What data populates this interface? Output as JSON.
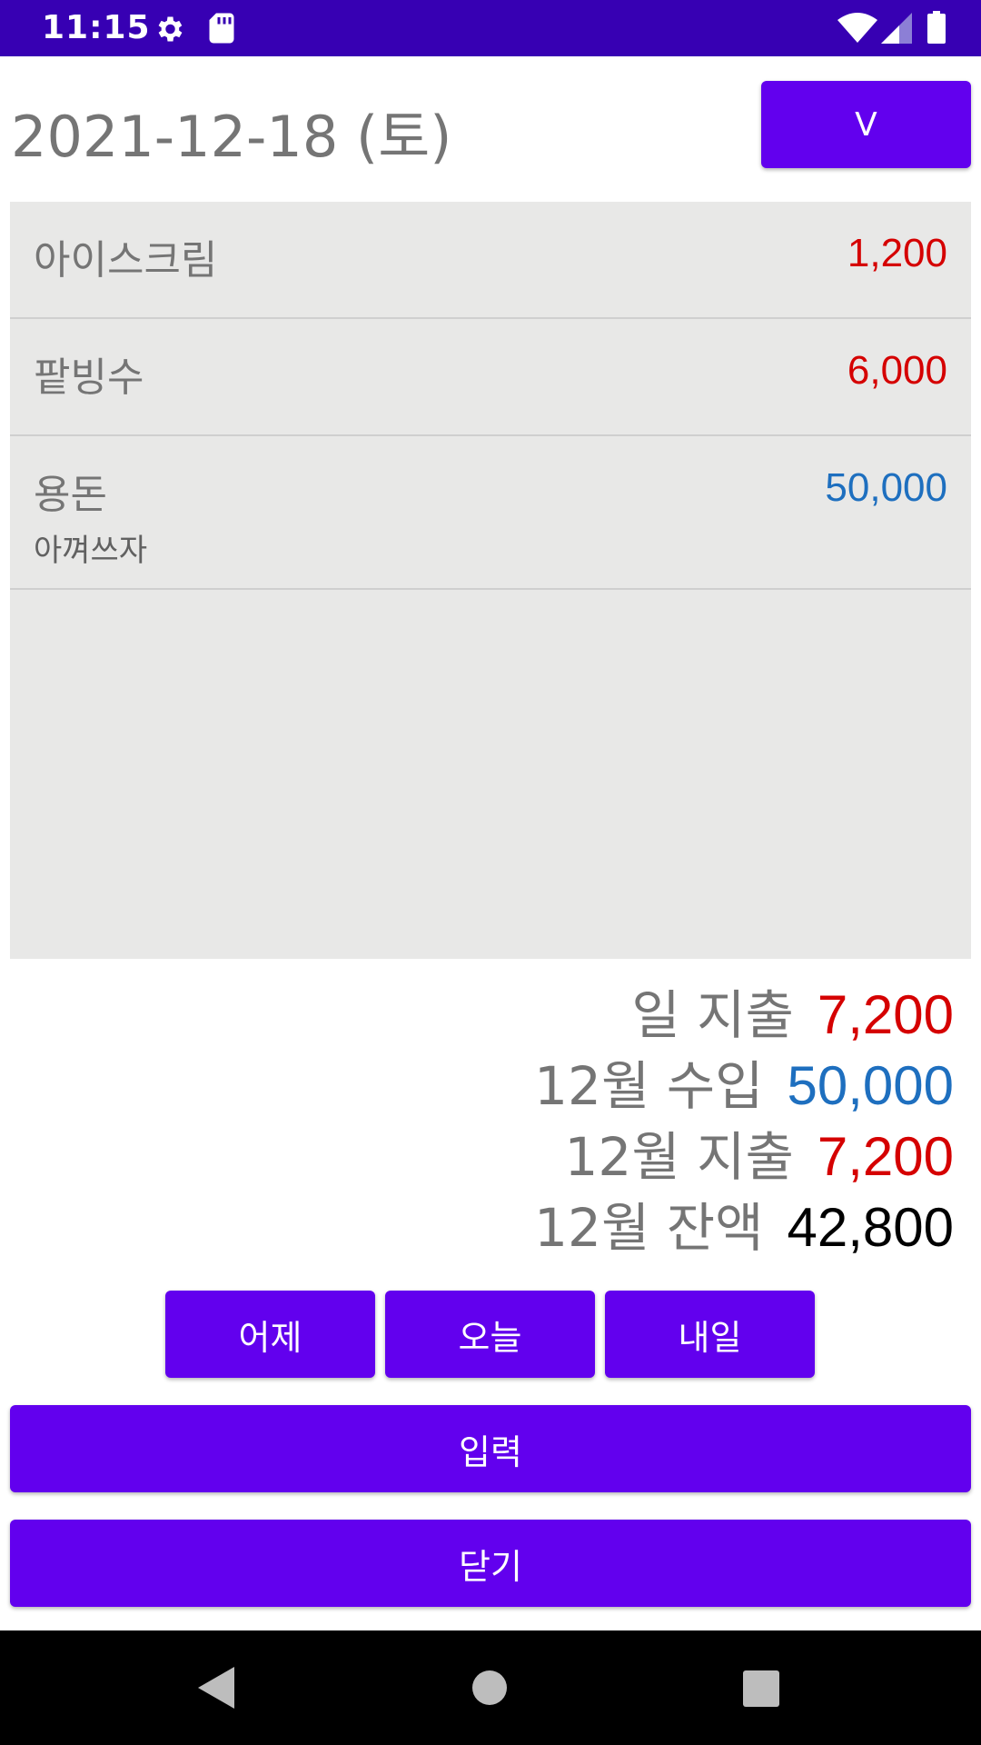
{
  "status_bar": {
    "time": "11:15",
    "icons": [
      "gear-icon",
      "sd-card-icon",
      "wifi-icon",
      "signal-icon",
      "battery-icon"
    ]
  },
  "header": {
    "date": "2021-12-18 (토)",
    "v_button": "V"
  },
  "entries": [
    {
      "name": "아이스크림",
      "amount": "1,200",
      "type": "expense"
    },
    {
      "name": "팥빙수",
      "amount": "6,000",
      "type": "expense"
    },
    {
      "name": "용돈",
      "memo": "아껴쓰자",
      "amount": "50,000",
      "type": "income"
    }
  ],
  "summary": {
    "daily_expense_label": "일 지출",
    "daily_expense_value": "7,200",
    "monthly_income_label": "12월 수입",
    "monthly_income_value": "50,000",
    "monthly_expense_label": "12월 지출",
    "monthly_expense_value": "7,200",
    "monthly_balance_label": "12월 잔액",
    "monthly_balance_value": "42,800"
  },
  "buttons": {
    "yesterday": "어제",
    "today": "오늘",
    "tomorrow": "내일",
    "input": "입력",
    "close": "닫기"
  },
  "colors": {
    "primary": "#6200ee",
    "status_bar": "#3700b3",
    "expense": "#d50000",
    "income": "#1e6fbf",
    "balance": "#000000",
    "list_background": "#e8e8e7"
  },
  "nav_bar": {
    "icons": [
      "back-icon",
      "home-icon",
      "recent-apps-icon"
    ]
  }
}
